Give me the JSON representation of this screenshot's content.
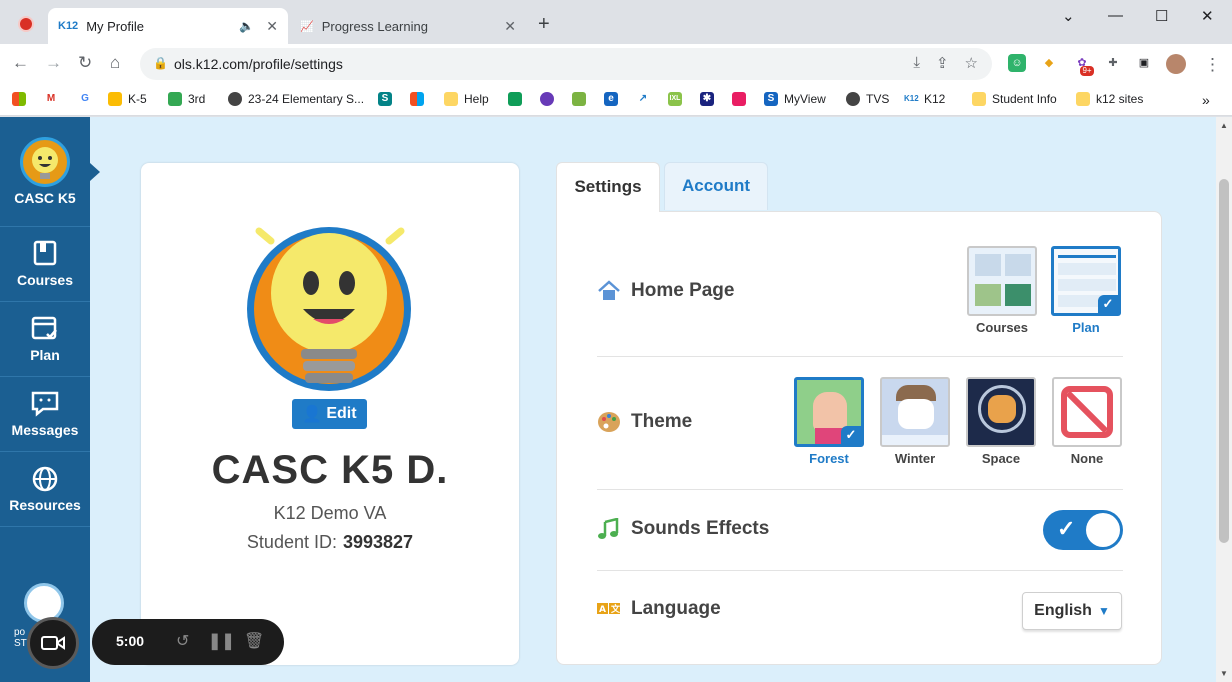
{
  "browser": {
    "tabs": [
      {
        "favicon": "K12",
        "title": "My Profile"
      },
      {
        "title": "Progress Learning"
      }
    ],
    "url": "ols.k12.com/profile/settings",
    "bookmarks": [
      "K-5",
      "3rd",
      "23-24 Elementary S...",
      "Help",
      "MyView",
      "TVS",
      "K12",
      "Student Info",
      "k12 sites"
    ],
    "extension_badge": "9+"
  },
  "sidebar": {
    "brand": "CASC K5",
    "items": [
      {
        "label": "Courses"
      },
      {
        "label": "Plan"
      },
      {
        "label": "Messages"
      },
      {
        "label": "Resources"
      }
    ],
    "mini_label_1": "po",
    "mini_label_2": "ST"
  },
  "profile": {
    "edit_label": "Edit",
    "name": "CASC K5 D.",
    "school": "K12 Demo VA",
    "student_id_label": "Student ID:",
    "student_id": "3993827"
  },
  "tabs": {
    "settings": "Settings",
    "account": "Account"
  },
  "settings": {
    "home_page": {
      "label": "Home Page",
      "options": [
        {
          "label": "Courses",
          "selected": false
        },
        {
          "label": "Plan",
          "selected": true
        }
      ]
    },
    "theme": {
      "label": "Theme",
      "options": [
        {
          "label": "Forest",
          "selected": true
        },
        {
          "label": "Winter",
          "selected": false
        },
        {
          "label": "Space",
          "selected": false
        },
        {
          "label": "None",
          "selected": false
        }
      ]
    },
    "sound": {
      "label": "Sounds Effects",
      "enabled": true
    },
    "language": {
      "label": "Language",
      "value": "English"
    }
  },
  "recorder": {
    "time": "5:00"
  },
  "colors": {
    "accent": "#1f7bc7",
    "sidebar": "#1b5f92",
    "background": "#dbeffb"
  }
}
